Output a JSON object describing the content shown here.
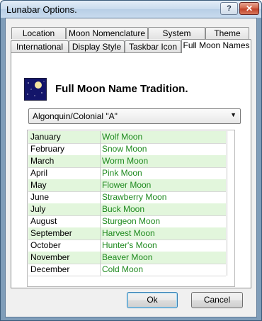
{
  "window": {
    "title": "Lunabar Options.",
    "help_label": "?",
    "close_label": "✕"
  },
  "tabs_row_back": [
    {
      "label": "Location"
    },
    {
      "label": "Moon Nomenclature"
    },
    {
      "label": "System"
    },
    {
      "label": "Theme"
    }
  ],
  "tabs_row_front": [
    {
      "label": "International"
    },
    {
      "label": "Display Style"
    },
    {
      "label": "Taskbar Icon"
    },
    {
      "label": "Full Moon Names",
      "active": true
    }
  ],
  "panel": {
    "icon": "moon-night-icon",
    "heading": "Full Moon Name Tradition.",
    "tradition_select": {
      "value": "Algonquin/Colonial \"A\"",
      "arrow": "▼"
    },
    "moons": [
      {
        "month": "January",
        "name": "Wolf Moon"
      },
      {
        "month": "February",
        "name": "Snow Moon"
      },
      {
        "month": "March",
        "name": "Worm Moon"
      },
      {
        "month": "April",
        "name": "Pink Moon"
      },
      {
        "month": "May",
        "name": "Flower Moon"
      },
      {
        "month": "June",
        "name": "Strawberry Moon"
      },
      {
        "month": "July",
        "name": "Buck Moon"
      },
      {
        "month": "August",
        "name": "Sturgeon Moon"
      },
      {
        "month": "September",
        "name": "Harvest Moon"
      },
      {
        "month": "October",
        "name": "Hunter's Moon"
      },
      {
        "month": "November",
        "name": "Beaver Moon"
      },
      {
        "month": "December",
        "name": "Cold Moon"
      }
    ]
  },
  "buttons": {
    "ok_label": "Ok",
    "cancel_label": "Cancel"
  },
  "colors": {
    "row_stripe": "#e2f6dc",
    "moon_name_text": "#1f8a1f",
    "icon_background": "#13156a"
  }
}
